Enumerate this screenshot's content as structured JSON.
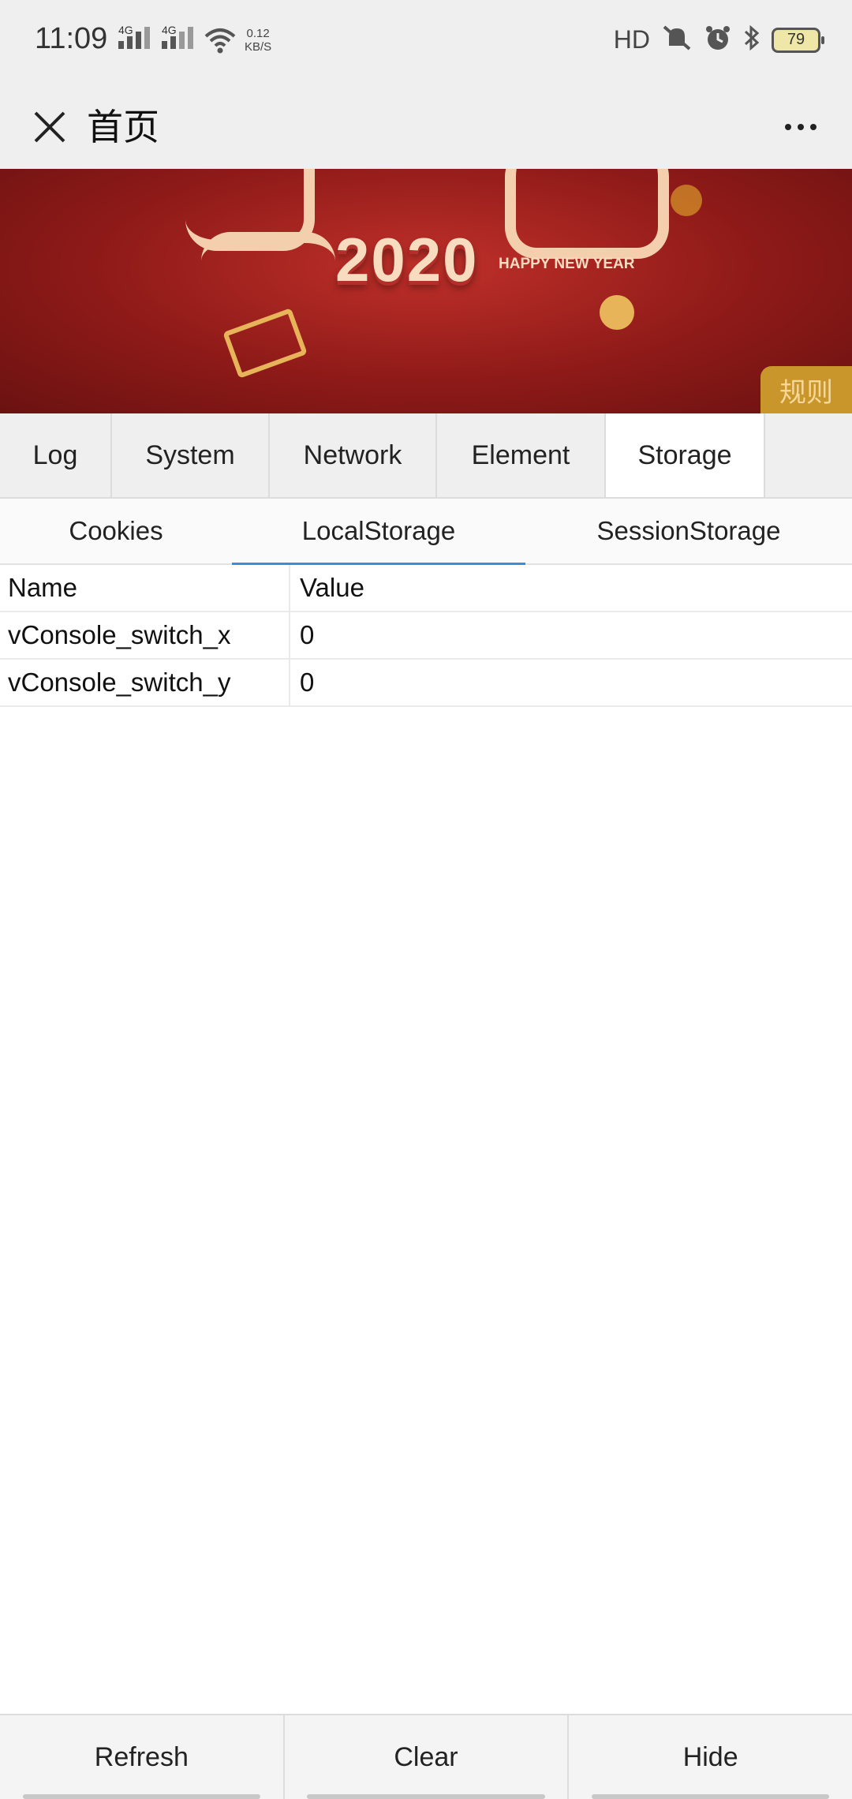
{
  "status_bar": {
    "time": "11:09",
    "network_1": "4G",
    "network_2": "4G",
    "speed_value": "0.12",
    "speed_unit": "KB/S",
    "hd": "HD",
    "battery": "79"
  },
  "title_bar": {
    "title": "首页"
  },
  "banner": {
    "headline": "2020",
    "subline": "HAPPY NEW YEAR",
    "rules_label": "规则"
  },
  "vconsole": {
    "tabs": [
      {
        "label": "Log"
      },
      {
        "label": "System"
      },
      {
        "label": "Network"
      },
      {
        "label": "Element"
      },
      {
        "label": "Storage"
      }
    ],
    "active_tab": "Storage",
    "subtabs": [
      {
        "label": "Cookies"
      },
      {
        "label": "LocalStorage"
      },
      {
        "label": "SessionStorage"
      }
    ],
    "active_subtab": "LocalStorage",
    "table": {
      "headers": {
        "name": "Name",
        "value": "Value"
      },
      "rows": [
        {
          "name": "vConsole_switch_x",
          "value": "0"
        },
        {
          "name": "vConsole_switch_y",
          "value": "0"
        }
      ]
    },
    "toolbar": {
      "refresh": "Refresh",
      "clear": "Clear",
      "hide": "Hide"
    }
  },
  "colors": {
    "accent_underline": "#3b8ed6",
    "banner_red": "#8e1a18"
  },
  "icons": [
    "signal-icon",
    "wifi-icon",
    "mute-icon",
    "alarm-icon",
    "bluetooth-icon",
    "battery-icon",
    "close-icon",
    "more-icon"
  ]
}
